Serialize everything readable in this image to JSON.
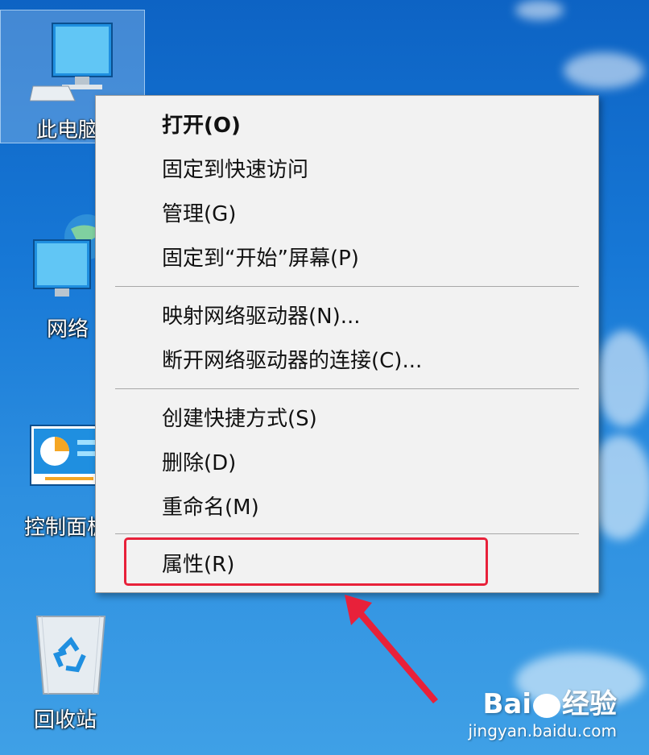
{
  "desktop": {
    "icons": [
      {
        "label": "此电脑"
      },
      {
        "label": "网络"
      },
      {
        "label": "控制面板"
      },
      {
        "label": "回收站"
      }
    ]
  },
  "context_menu": {
    "items": [
      {
        "label": "打开(O)",
        "bold": true
      },
      {
        "label": "固定到快速访问"
      },
      {
        "label": "管理(G)"
      },
      {
        "label": "固定到“开始”屏幕(P)"
      },
      {
        "label": "映射网络驱动器(N)..."
      },
      {
        "label": "断开网络驱动器的连接(C)..."
      },
      {
        "label": "创建快捷方式(S)"
      },
      {
        "label": "删除(D)"
      },
      {
        "label": "重命名(M)"
      },
      {
        "label": "属性(R)"
      }
    ]
  },
  "annotation": {
    "color": "#e8213a",
    "target": "属性(R)"
  },
  "watermark": {
    "brand": "Bai",
    "brand_suffix": "经验",
    "url": "jingyan.baidu.com"
  }
}
